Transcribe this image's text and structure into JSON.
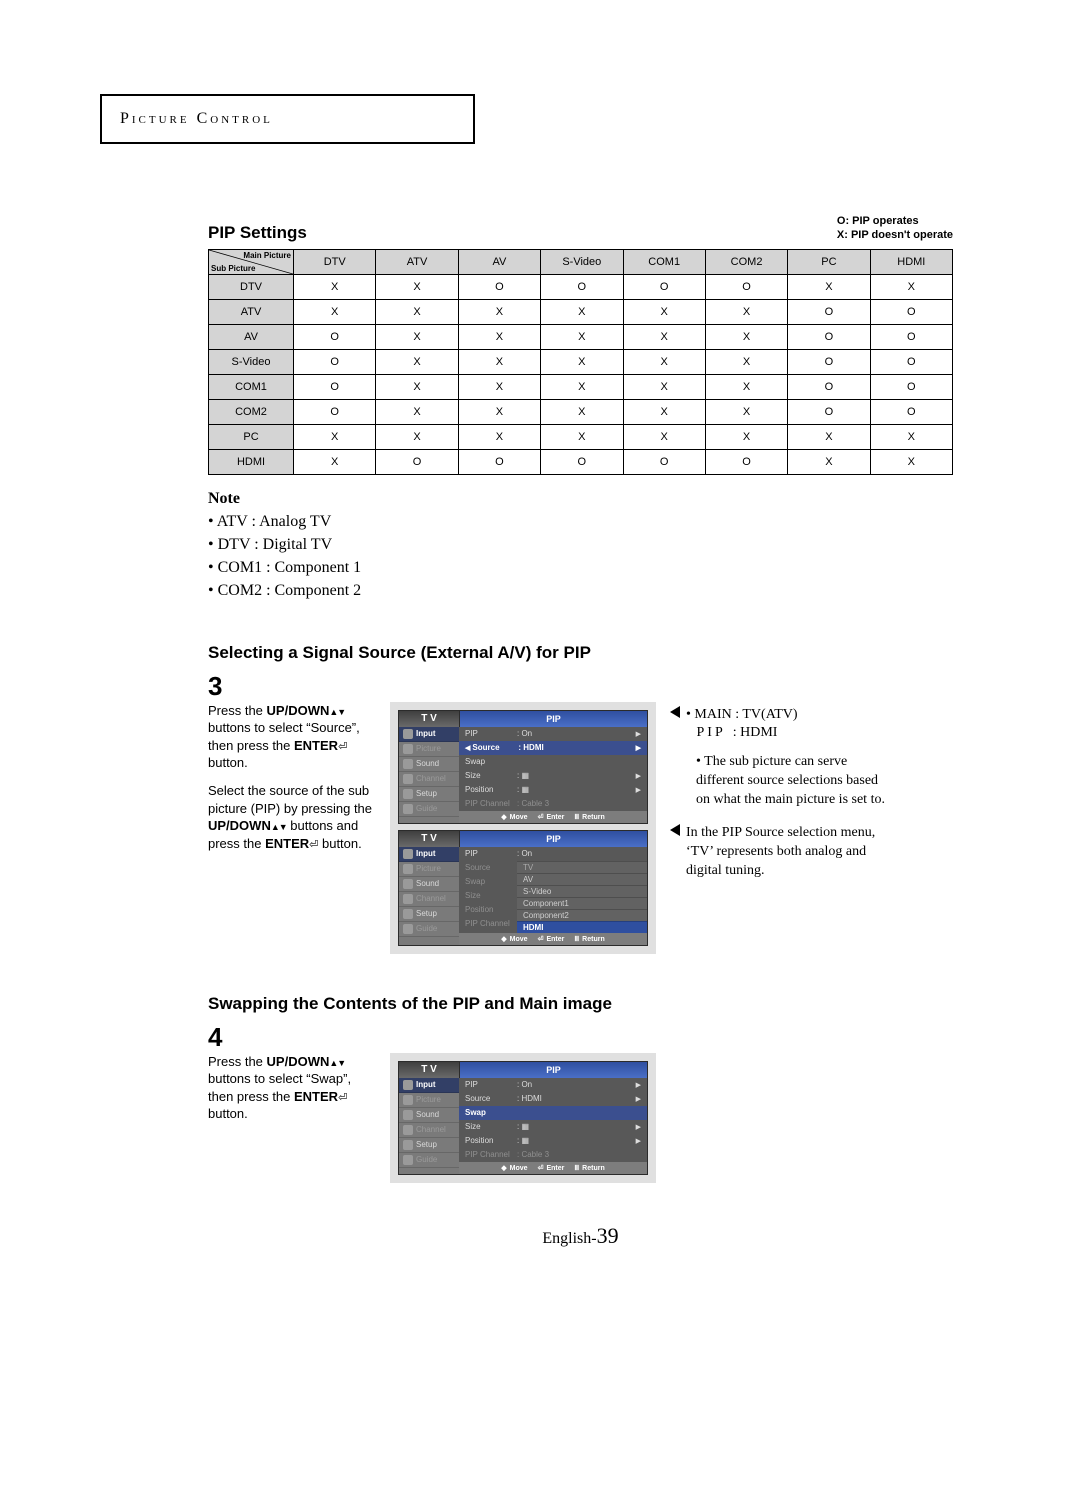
{
  "chapter_title": "Picture Control",
  "pip_table": {
    "heading": "PIP Settings",
    "legend_line1": "O: PIP operates",
    "legend_line2": "X: PIP doesn't operate",
    "corner_top": "Main Picture",
    "corner_bottom": "Sub Picture",
    "cols": [
      "DTV",
      "ATV",
      "AV",
      "S-Video",
      "COM1",
      "COM2",
      "PC",
      "HDMI"
    ],
    "rows": [
      {
        "label": "DTV",
        "cells": [
          "X",
          "X",
          "O",
          "O",
          "O",
          "O",
          "X",
          "X"
        ]
      },
      {
        "label": "ATV",
        "cells": [
          "X",
          "X",
          "X",
          "X",
          "X",
          "X",
          "O",
          "O"
        ]
      },
      {
        "label": "AV",
        "cells": [
          "O",
          "X",
          "X",
          "X",
          "X",
          "X",
          "O",
          "O"
        ]
      },
      {
        "label": "S-Video",
        "cells": [
          "O",
          "X",
          "X",
          "X",
          "X",
          "X",
          "O",
          "O"
        ]
      },
      {
        "label": "COM1",
        "cells": [
          "O",
          "X",
          "X",
          "X",
          "X",
          "X",
          "O",
          "O"
        ]
      },
      {
        "label": "COM2",
        "cells": [
          "O",
          "X",
          "X",
          "X",
          "X",
          "X",
          "O",
          "O"
        ]
      },
      {
        "label": "PC",
        "cells": [
          "X",
          "X",
          "X",
          "X",
          "X",
          "X",
          "X",
          "X"
        ]
      },
      {
        "label": "HDMI",
        "cells": [
          "X",
          "O",
          "O",
          "O",
          "O",
          "O",
          "X",
          "X"
        ]
      }
    ]
  },
  "note": {
    "title": "Note",
    "items": [
      "ATV : Analog TV",
      "DTV : Digital TV",
      "COM1 : Component 1",
      "COM2 : Component 2"
    ]
  },
  "section3": {
    "heading": "Selecting a Signal Source (External A/V) for PIP",
    "number": "3",
    "para1_a": "Press the ",
    "para1_b": "UP/DOWN",
    "para1_c": " buttons to select “Source”, then press the ",
    "para1_d": "ENTER",
    "para1_e": " button.",
    "para2_a": "Select the source of the sub picture (PIP) by pressing the ",
    "para2_b": "UP/DOWN",
    "para2_c": "  buttons and press the ",
    "para2_d": "ENTER",
    "para2_e": " button.",
    "side1_main": "MAIN : TV(ATV)",
    "side1_pip_label": "PIP",
    "side1_pip_value": ": HDMI",
    "side1_bullet": "The sub picture can serve different source selections based on what the main picture is set to.",
    "side2": "In the PIP Source selection menu, ‘TV’ represents both analog and digital tuning."
  },
  "section4": {
    "heading": "Swapping the Contents of the PIP and Main image",
    "number": "4",
    "para1_a": "Press the ",
    "para1_b": "UP/DOWN",
    "para1_c": " buttons to select “Swap”, then press the ",
    "para1_d": "ENTER",
    "para1_e": " button."
  },
  "osd": {
    "tv": "T V",
    "title": "PIP",
    "side": {
      "input": "Input",
      "picture": "Picture",
      "sound": "Sound",
      "channel": "Channel",
      "setup": "Setup",
      "guide": "Guide"
    },
    "rows": {
      "pip": "PIP",
      "pip_v": ": On",
      "source": "Source",
      "source_v": ": HDMI",
      "swap": "Swap",
      "size": "Size",
      "position": "Position",
      "pipchannel": "PIP Channel",
      "pipchannel_v": ": Cable 3"
    },
    "footer": {
      "move": "Move",
      "enter": "Enter",
      "return": "Return"
    },
    "dropdown": {
      "tv": "TV",
      "av": "AV",
      "svideo": "S-Video",
      "comp1": "Component1",
      "comp2": "Component2",
      "hdmi": "HDMI"
    }
  },
  "pagenum_prefix": "English-",
  "pagenum": "39"
}
